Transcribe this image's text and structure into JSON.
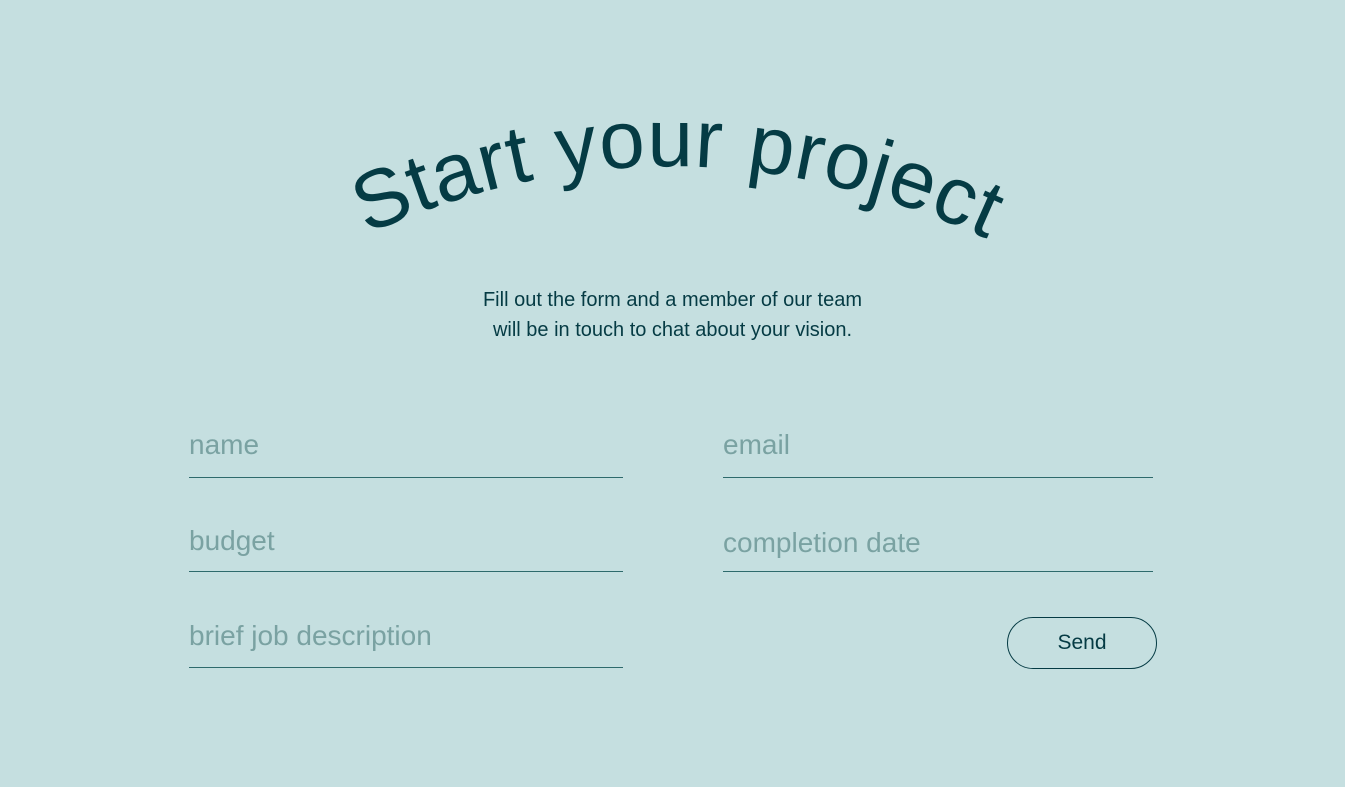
{
  "page": {
    "background_color": "#c5dfe0",
    "text_color": "#053b44",
    "placeholder_color": "#7aa2a2"
  },
  "header": {
    "title": "Start your project",
    "subtitle_line1": "Fill out the form and a member of our team",
    "subtitle_line2": "will be in touch to chat about your vision."
  },
  "form": {
    "name": {
      "placeholder": "name",
      "value": ""
    },
    "email": {
      "placeholder": "email",
      "value": ""
    },
    "budget": {
      "placeholder": "budget",
      "value": ""
    },
    "completion_date": {
      "placeholder": "completion date",
      "value": ""
    },
    "description": {
      "placeholder": "brief job description",
      "value": ""
    },
    "send_label": "Send"
  }
}
